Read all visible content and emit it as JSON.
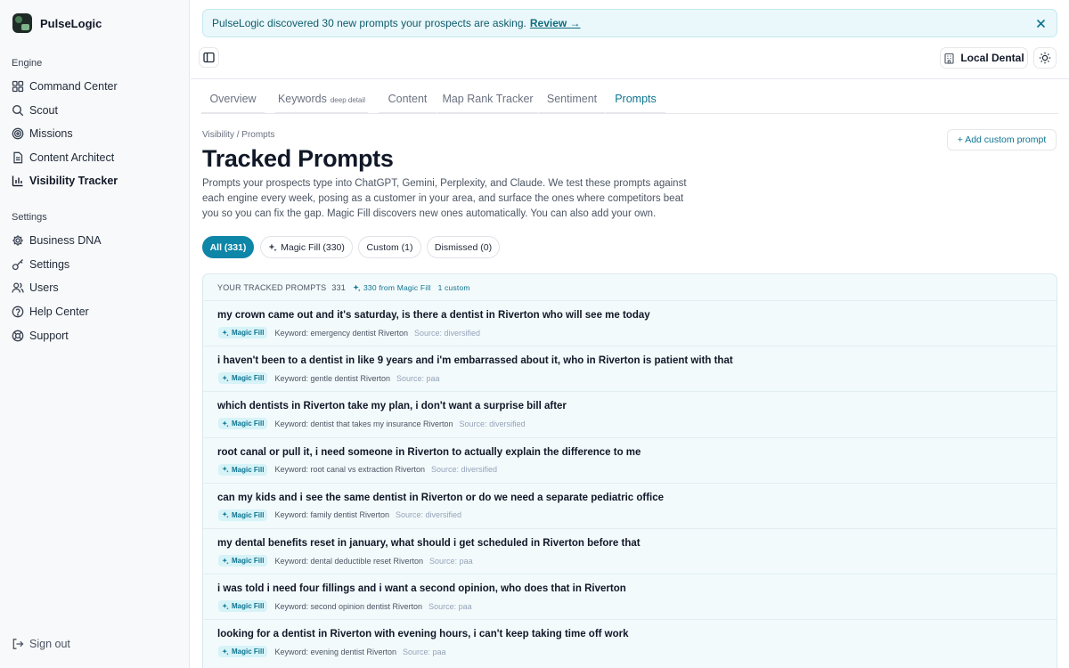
{
  "app": {
    "name": "PulseLogic"
  },
  "sidebar": {
    "engine_label": "Engine",
    "settings_label": "Settings",
    "engine_items": [
      {
        "label": "Command Center",
        "icon": "grid-icon"
      },
      {
        "label": "Scout",
        "icon": "search-icon"
      },
      {
        "label": "Missions",
        "icon": "target-icon"
      },
      {
        "label": "Content Architect",
        "icon": "document-icon"
      },
      {
        "label": "Visibility Tracker",
        "icon": "bar-chart-icon",
        "active": true
      }
    ],
    "settings_items": [
      {
        "label": "Business DNA",
        "icon": "gear-icon"
      },
      {
        "label": "Settings",
        "icon": "key-icon"
      },
      {
        "label": "Users",
        "icon": "users-icon"
      },
      {
        "label": "Help Center",
        "icon": "help-circle-icon"
      },
      {
        "label": "Support",
        "icon": "lifebuoy-icon"
      }
    ],
    "signout": "Sign out"
  },
  "banner": {
    "text": "PulseLogic discovered 30 new prompts your prospects are asking.",
    "link": "Review →"
  },
  "topbar": {
    "location": "Local Dental"
  },
  "tabs": [
    {
      "label": "Overview"
    },
    {
      "label": "Keywords",
      "sub": "deep detail"
    },
    {
      "label": "Content"
    },
    {
      "label": "Map Rank Tracker"
    },
    {
      "label": "Sentiment"
    },
    {
      "label": "Prompts",
      "active": true
    }
  ],
  "page": {
    "breadcrumb": "Visibility / Prompts",
    "title": "Tracked Prompts",
    "description": "Prompts your prospects type into ChatGPT, Gemini, Perplexity, and Claude. We test these prompts against each engine every week, posing as a customer in your area, and surface the ones where competitors beat you so you can fix the gap. Magic Fill discovers new ones automatically. You can also add your own.",
    "add_button": "+ Add custom prompt"
  },
  "filters": [
    {
      "label": "All (331)",
      "active": true
    },
    {
      "label": "Magic Fill (330)"
    },
    {
      "label": "Custom (1)"
    },
    {
      "label": "Dismissed (0)"
    }
  ],
  "list": {
    "header": "YOUR TRACKED PROMPTS",
    "count": "331",
    "magic_fill_count": "330 from Magic Fill",
    "custom_count": "1 custom",
    "badge": "Magic Fill",
    "rows": [
      {
        "text": "my crown came out and it's saturday, is there a dentist in Riverton who will see me today",
        "keyword": "Keyword: emergency dentist Riverton",
        "source": "Source: diversified"
      },
      {
        "text": "i haven't been to a dentist in like 9 years and i'm embarrassed about it, who in Riverton is patient with that",
        "keyword": "Keyword: gentle dentist Riverton",
        "source": "Source: paa"
      },
      {
        "text": "which dentists in Riverton take my plan, i don't want a surprise bill after",
        "keyword": "Keyword: dentist that takes my insurance Riverton",
        "source": "Source: diversified"
      },
      {
        "text": "root canal or pull it, i need someone in Riverton to actually explain the difference to me",
        "keyword": "Keyword: root canal vs extraction Riverton",
        "source": "Source: diversified"
      },
      {
        "text": "can my kids and i see the same dentist in Riverton or do we need a separate pediatric office",
        "keyword": "Keyword: family dentist Riverton",
        "source": "Source: diversified"
      },
      {
        "text": "my dental benefits reset in january, what should i get scheduled in Riverton before that",
        "keyword": "Keyword: dental deductible reset Riverton",
        "source": "Source: paa"
      },
      {
        "text": "i was told i need four fillings and i want a second opinion, who does that in Riverton",
        "keyword": "Keyword: second opinion dentist Riverton",
        "source": "Source: paa"
      },
      {
        "text": "looking for a dentist in Riverton with evening hours, i can't keep taking time off work",
        "keyword": "Keyword: evening dentist Riverton",
        "source": "Source: paa"
      }
    ]
  }
}
